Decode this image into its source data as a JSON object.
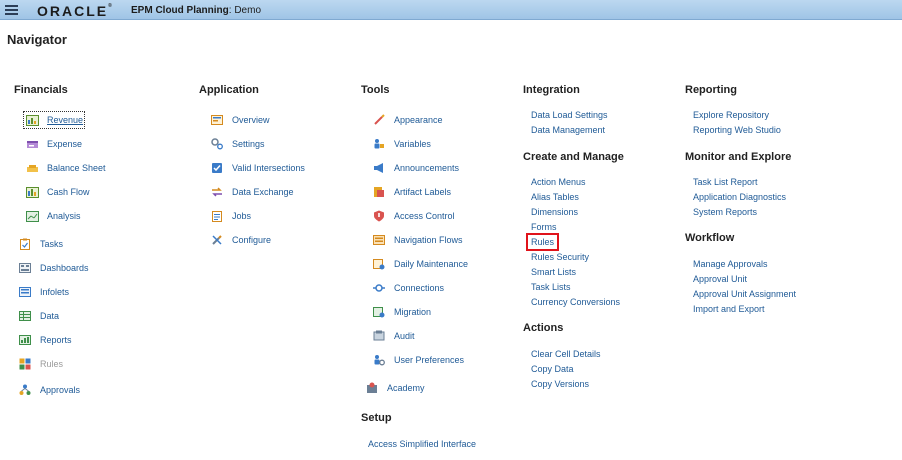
{
  "header": {
    "brand": "ORACLE",
    "app_name": "EPM Cloud Planning",
    "app_suffix": ": Demo"
  },
  "page_title": "Navigator",
  "financials": {
    "title": "Financials",
    "sub_items": [
      {
        "label": "Revenue"
      },
      {
        "label": "Expense"
      },
      {
        "label": "Balance Sheet"
      },
      {
        "label": "Cash Flow"
      },
      {
        "label": "Analysis"
      }
    ],
    "items": [
      {
        "label": "Tasks"
      },
      {
        "label": "Dashboards"
      },
      {
        "label": "Infolets"
      },
      {
        "label": "Data"
      },
      {
        "label": "Reports"
      },
      {
        "label": "Rules"
      },
      {
        "label": "Approvals"
      }
    ]
  },
  "application": {
    "title": "Application",
    "items": [
      {
        "label": "Overview"
      },
      {
        "label": "Settings"
      },
      {
        "label": "Valid Intersections"
      },
      {
        "label": "Data Exchange"
      },
      {
        "label": "Jobs"
      },
      {
        "label": "Configure"
      }
    ]
  },
  "tools": {
    "title": "Tools",
    "items": [
      {
        "label": "Appearance"
      },
      {
        "label": "Variables"
      },
      {
        "label": "Announcements"
      },
      {
        "label": "Artifact Labels"
      },
      {
        "label": "Access Control"
      },
      {
        "label": "Navigation Flows"
      },
      {
        "label": "Daily Maintenance"
      },
      {
        "label": "Connections"
      },
      {
        "label": "Migration"
      },
      {
        "label": "Audit"
      },
      {
        "label": "User Preferences"
      }
    ],
    "academy": "Academy"
  },
  "setup": {
    "title": "Setup",
    "items": [
      {
        "label": "Access Simplified Interface"
      }
    ]
  },
  "integration": {
    "title": "Integration",
    "items": [
      {
        "label": "Data Load Settings"
      },
      {
        "label": "Data Management"
      }
    ]
  },
  "create_manage": {
    "title": "Create and Manage",
    "items": [
      {
        "label": "Action Menus"
      },
      {
        "label": "Alias Tables"
      },
      {
        "label": "Dimensions"
      },
      {
        "label": "Forms"
      },
      {
        "label": "Rules"
      },
      {
        "label": "Rules Security"
      },
      {
        "label": "Smart Lists"
      },
      {
        "label": "Task Lists"
      },
      {
        "label": "Currency Conversions"
      }
    ]
  },
  "actions": {
    "title": "Actions",
    "items": [
      {
        "label": "Clear Cell Details"
      },
      {
        "label": "Copy Data"
      },
      {
        "label": "Copy Versions"
      }
    ]
  },
  "reporting": {
    "title": "Reporting",
    "items": [
      {
        "label": "Explore Repository"
      },
      {
        "label": "Reporting Web Studio"
      }
    ]
  },
  "monitor_explore": {
    "title": "Monitor and Explore",
    "items": [
      {
        "label": "Task List Report"
      },
      {
        "label": "Application Diagnostics"
      },
      {
        "label": "System Reports"
      }
    ]
  },
  "workflow": {
    "title": "Workflow",
    "items": [
      {
        "label": "Manage Approvals"
      },
      {
        "label": "Approval Unit"
      },
      {
        "label": "Approval Unit Assignment"
      },
      {
        "label": "Import and Export"
      }
    ]
  },
  "colors": {
    "link": "#1f5a96",
    "highlight": "#e0131b",
    "header_bg": "#a9cdec"
  }
}
